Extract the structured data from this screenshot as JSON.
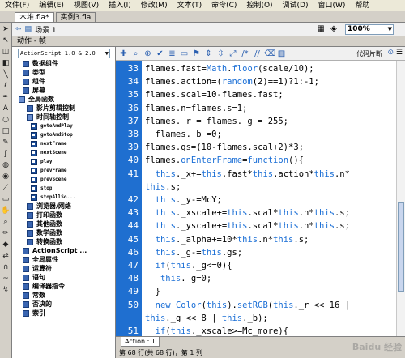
{
  "menubar": {
    "items": [
      "文件(F)",
      "编辑(E)",
      "视图(V)",
      "插入(I)",
      "修改(M)",
      "文本(T)",
      "命令(C)",
      "控制(O)",
      "调试(D)",
      "窗口(W)",
      "帮助"
    ]
  },
  "doc_tabs": [
    {
      "label": "木堆.fla*"
    },
    {
      "label": "实例3.fla"
    }
  ],
  "scene": {
    "label": "场景 1",
    "zoom": "100%"
  },
  "actions_panel": {
    "title": "动作 - 帧",
    "language_select": "ActionScript 1.0 & 2.0",
    "tree": [
      {
        "label": "数据组件",
        "type": "book",
        "indent": 1
      },
      {
        "label": "类型",
        "type": "book",
        "indent": 1
      },
      {
        "label": "组件",
        "type": "book",
        "indent": 1
      },
      {
        "label": "屏幕",
        "type": "book",
        "indent": 1
      },
      {
        "label": "全局函数",
        "type": "book-open",
        "indent": 0
      },
      {
        "label": "影片剪辑控制",
        "type": "book",
        "indent": 2
      },
      {
        "label": "时间轴控制",
        "type": "book-open",
        "indent": 2
      },
      {
        "label": "gotoAndPlay",
        "type": "leaf",
        "indent": 3
      },
      {
        "label": "gotoAndStop",
        "type": "leaf",
        "indent": 3
      },
      {
        "label": "nextFrame",
        "type": "leaf",
        "indent": 3
      },
      {
        "label": "nextScene",
        "type": "leaf",
        "indent": 3
      },
      {
        "label": "play",
        "type": "leaf",
        "indent": 3
      },
      {
        "label": "prevFrame",
        "type": "leaf",
        "indent": 3
      },
      {
        "label": "prevScene",
        "type": "leaf",
        "indent": 3
      },
      {
        "label": "stop",
        "type": "leaf",
        "indent": 3
      },
      {
        "label": "stopAllSo...",
        "type": "leaf",
        "indent": 3
      },
      {
        "label": "浏览器/网络",
        "type": "book",
        "indent": 2
      },
      {
        "label": "打印函数",
        "type": "book",
        "indent": 2
      },
      {
        "label": "其他函数",
        "type": "book",
        "indent": 2
      },
      {
        "label": "数学函数",
        "type": "book",
        "indent": 2
      },
      {
        "label": "转换函数",
        "type": "book",
        "indent": 2
      },
      {
        "label": "ActionScript ...",
        "type": "book",
        "indent": 1
      },
      {
        "label": "全局属性",
        "type": "book",
        "indent": 1
      },
      {
        "label": "运算符",
        "type": "book",
        "indent": 1
      },
      {
        "label": "语句",
        "type": "book",
        "indent": 1
      },
      {
        "label": "编译器指令",
        "type": "book",
        "indent": 1
      },
      {
        "label": "常数",
        "type": "book",
        "indent": 1
      },
      {
        "label": "否决的",
        "type": "book",
        "indent": 1
      },
      {
        "label": "索引",
        "type": "book",
        "indent": 1
      }
    ]
  },
  "editor": {
    "snippets_label": "代码片断",
    "lines": [
      {
        "ln": "33",
        "code": "flames.fast=Math.floor(scale/10);"
      },
      {
        "ln": "34",
        "code": "flames.action=(random(2)==1)?1:-1;"
      },
      {
        "ln": "35",
        "code": "flames.scal=10-flames.fast;"
      },
      {
        "ln": "36",
        "code": "flames.n=flames.s=1;"
      },
      {
        "ln": "37",
        "code": "flames._r = flames._g = 255;"
      },
      {
        "ln": "38",
        "code": "  flames._b =0;"
      },
      {
        "ln": "39",
        "code": "flames.gs=(10-flames.scal+2)*3;"
      },
      {
        "ln": "40",
        "code": "flames.onEnterFrame=function(){"
      },
      {
        "ln": "41",
        "code": "  this._x+=this.fast*this.action*this.n*"
      },
      {
        "ln": "",
        "code": "this.s;"
      },
      {
        "ln": "42",
        "code": "  this._y-=McY;"
      },
      {
        "ln": "43",
        "code": "  this._xscale+=this.scal*this.n*this.s;"
      },
      {
        "ln": "44",
        "code": "  this._yscale+=this.scal*this.n*this.s;"
      },
      {
        "ln": "45",
        "code": "  this._alpha+=10*this.n*this.s;"
      },
      {
        "ln": "46",
        "code": "  this._g-=this.gs;"
      },
      {
        "ln": "47",
        "code": "  if(this._g<=0){"
      },
      {
        "ln": "48",
        "code": "   this._g=0;"
      },
      {
        "ln": "49",
        "code": "  }"
      },
      {
        "ln": "50",
        "code": "  new Color(this).setRGB(this._r << 16 |"
      },
      {
        "ln": "",
        "code": "this._g << 8 | this._b);"
      },
      {
        "ln": "51",
        "code": "  if(this._xscale>=Mc_more){"
      }
    ],
    "code_tab": "Action : 1",
    "status": "第 68 行(共 68 行)，第 1 列"
  },
  "watermark": "Baidu 经验",
  "colors": {
    "gutter": "#1f6fd0",
    "keyword": "#1b6fd6"
  }
}
